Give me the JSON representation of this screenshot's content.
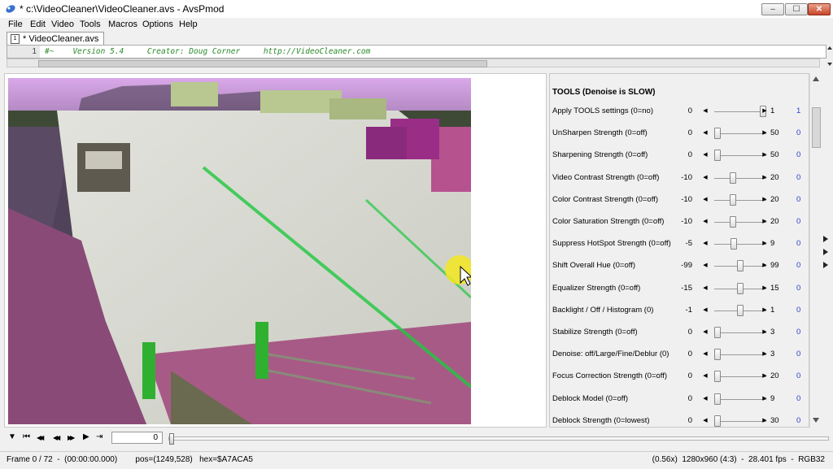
{
  "window": {
    "title": "* c:\\VideoCleaner\\VideoCleaner.avs - AvsPmod",
    "min_glyph": "–",
    "max_glyph": "☐",
    "close_glyph": "✕"
  },
  "menu": [
    "File",
    "Edit",
    "Video",
    "Tools",
    "Macros",
    "Options",
    "Help"
  ],
  "tab": {
    "icon_glyph": "1",
    "label": "* VideoCleaner.avs"
  },
  "editor": {
    "line_number": "1",
    "code": "#~    Version 5.4     Creator: Doug Corner     http://VideoCleaner.com"
  },
  "tools": {
    "title": "TOOLS (Denoise is SLOW)",
    "rows": [
      {
        "label": "Apply TOOLS settings (0=no)",
        "min": "0",
        "max": "1",
        "value": "1",
        "pos": 1
      },
      {
        "label": "UnSharpen Strength (0=off)",
        "min": "0",
        "max": "50",
        "value": "0",
        "pos": 0
      },
      {
        "label": "Sharpening Strength (0=off)",
        "min": "0",
        "max": "50",
        "value": "0",
        "pos": 0
      },
      {
        "label": "Video Contrast Strength (0=off)",
        "min": "-10",
        "max": "20",
        "value": "0",
        "pos": 0.333
      },
      {
        "label": "Color Contrast Strength (0=off)",
        "min": "-10",
        "max": "20",
        "value": "0",
        "pos": 0.333
      },
      {
        "label": "Color Saturation Strength (0=off)",
        "min": "-10",
        "max": "20",
        "value": "0",
        "pos": 0.333
      },
      {
        "label": "Suppress HotSpot Strength (0=off)",
        "min": "-5",
        "max": "9",
        "value": "0",
        "pos": 0.357
      },
      {
        "label": "Shift Overall Hue (0=off)",
        "min": "-99",
        "max": "99",
        "value": "0",
        "pos": 0.5
      },
      {
        "label": "Equalizer Strength (0=off)",
        "min": "-15",
        "max": "15",
        "value": "0",
        "pos": 0.5
      },
      {
        "label": "Backlight / Off / Histogram (0)",
        "min": "-1",
        "max": "1",
        "value": "0",
        "pos": 0.5
      },
      {
        "label": "Stabilize Strength (0=off)",
        "min": "0",
        "max": "3",
        "value": "0",
        "pos": 0
      },
      {
        "label": "Denoise: off/Large/Fine/Deblur (0)",
        "min": "0",
        "max": "3",
        "value": "0",
        "pos": 0
      },
      {
        "label": "Focus Correction Strength (0=off)",
        "min": "0",
        "max": "20",
        "value": "0",
        "pos": 0
      },
      {
        "label": "Deblock Model (0=off)",
        "min": "0",
        "max": "9",
        "value": "0",
        "pos": 0
      },
      {
        "label": "Deblock Strength (0=lowest)",
        "min": "0",
        "max": "30",
        "value": "0",
        "pos": 0
      }
    ]
  },
  "playback": {
    "frame_value": "0",
    "dropdown_glyph": "▼",
    "first_glyph": "⏮",
    "rewind_glyph": "◀◀",
    "back_glyph": "◀◀",
    "forward_glyph": "▶▶",
    "last_glyph": "⏭",
    "play_glyph": "▶",
    "jump_glyph": "⇥",
    "position": 0
  },
  "status": {
    "left": "Frame 0 / 72  -  (00:00:00.000)        pos=(1249,528)   hex=$A7ACA5",
    "right": "(0.56x)  1280x960 (4:3)  -  28.401 fps  -  RGB32"
  }
}
